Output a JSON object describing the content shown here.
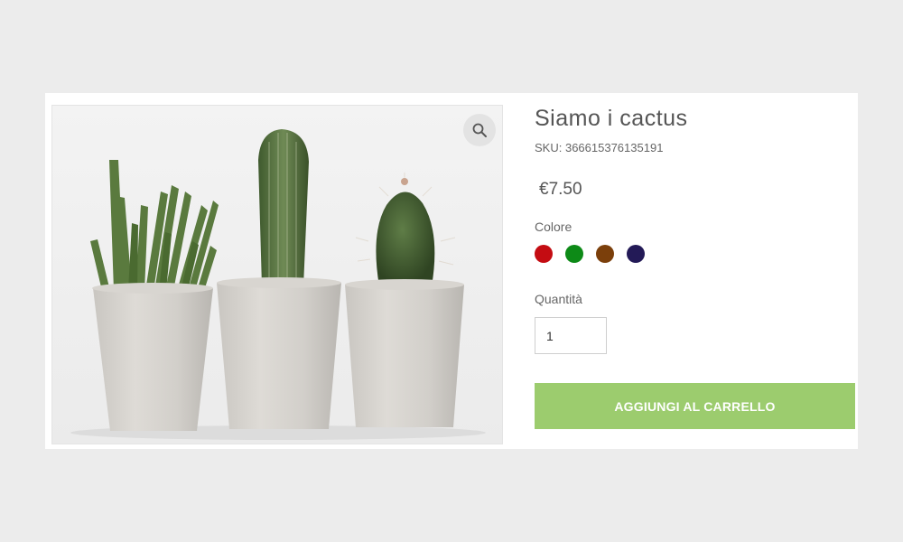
{
  "product": {
    "title": "Siamo i cactus",
    "sku_prefix": "SKU:",
    "sku": "366615376135191",
    "price": "€7.50",
    "image_alt": "Three cacti in white pots"
  },
  "gallery": {
    "zoom_icon": "magnifier-icon"
  },
  "options": {
    "color_label": "Colore",
    "colors": [
      {
        "name": "red",
        "hex": "#c40c12"
      },
      {
        "name": "green",
        "hex": "#0d8a17"
      },
      {
        "name": "brown",
        "hex": "#7b3f0b"
      },
      {
        "name": "navy",
        "hex": "#231a57"
      }
    ],
    "quantity_label": "Quantità",
    "quantity_value": "1"
  },
  "actions": {
    "add_to_cart_label": "AGGIUNGI AL CARRELLO"
  },
  "theme": {
    "accent": "#9ccc6e",
    "page_background": "#ececec"
  }
}
